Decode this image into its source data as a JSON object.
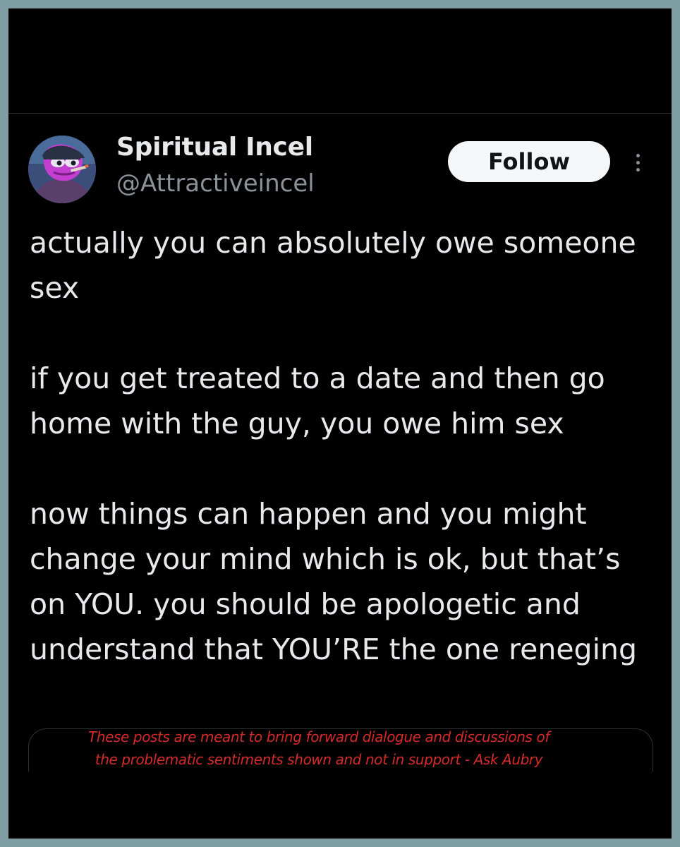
{
  "author": {
    "name": "Spiritual Incel",
    "handle": "@Attractiveincel"
  },
  "actions": {
    "follow_label": "Follow",
    "more_icon": "more-vertical-icon"
  },
  "tweet": {
    "paragraphs": [
      "actually you can absolutely owe someone sex",
      "if you get treated to a date and then go home with the guy, you owe him sex",
      "now things can happen and you might change your mind which is ok, but that’s on YOU. you should be apologetic and understand that YOU’RE the one reneging"
    ]
  },
  "disclaimer": {
    "line1": "These posts are meant to bring forward dialogue and discussions of",
    "line2": "the problematic sentiments shown and not in support - Ask Aubry"
  },
  "colors": {
    "frame_border": "#7e9ea3",
    "background": "#000000",
    "text_primary": "#e7e9ea",
    "text_secondary": "#8b9299",
    "disclaimer": "#d42a2a"
  }
}
